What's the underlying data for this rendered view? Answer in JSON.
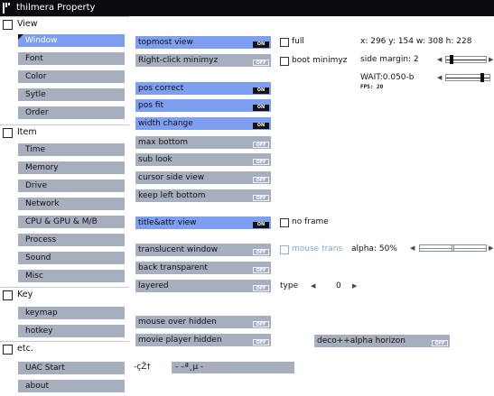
{
  "window": {
    "title": "thilmera Property"
  },
  "sidebar": {
    "sections": [
      {
        "title": "View",
        "items": [
          "Window",
          "Font",
          "Color",
          "Sytle",
          "Order"
        ],
        "selected": "Window"
      },
      {
        "title": "Item",
        "items": [
          "Time",
          "Memory",
          "Drive",
          "Network",
          "CPU & GPU & M/B",
          "Process",
          "Sound",
          "Misc"
        ]
      },
      {
        "title": "Key",
        "items": [
          "keymap",
          "hotkey"
        ]
      },
      {
        "title": "etc.",
        "items": [
          "UAC Start",
          "about"
        ]
      }
    ]
  },
  "main": {
    "toggle_on": "ON",
    "toggle_off": "OFF",
    "buttons": [
      {
        "label": "topmost view",
        "state": "on"
      },
      {
        "label": "Right-click minimyz",
        "state": "off"
      },
      {
        "label": "pos correct",
        "state": "on"
      },
      {
        "label": "pos fit",
        "state": "on"
      },
      {
        "label": "width change",
        "state": "on"
      },
      {
        "label": "max bottom",
        "state": "off"
      },
      {
        "label": "sub look",
        "state": "off"
      },
      {
        "label": "cursor side view",
        "state": "off"
      },
      {
        "label": "keep left bottom",
        "state": "off"
      },
      {
        "label": "title&attr view",
        "state": "on"
      },
      {
        "label": "translucent window",
        "state": "off"
      },
      {
        "label": "back transparent",
        "state": "off"
      },
      {
        "label": "layered",
        "state": "off"
      },
      {
        "label": "mouse over hidden",
        "state": "off"
      },
      {
        "label": "movie player hidden",
        "state": "off"
      }
    ],
    "checks": {
      "full": "full",
      "boot_minimyz": "boot minimyz",
      "no_frame": "no frame",
      "mouse_trans": "mouse trans"
    },
    "info": {
      "geometry": "x: 296 y: 154 w: 308 h: 228",
      "side_margin": "side margin: 2",
      "wait": "WAIT:0.050-b",
      "fps": "FPS:  20",
      "alpha": "alpha: 50%",
      "type_label": "type",
      "type_value": "0"
    },
    "values": {
      "side_margin_level": 0.1,
      "wait_level": 0.86,
      "alpha_level": 0.5
    },
    "extra_button": {
      "label": "deco++alpha horizon",
      "state": "off"
    },
    "bottom": {
      "label": "-çŽ†",
      "field": " - –ª¸µ -"
    }
  }
}
